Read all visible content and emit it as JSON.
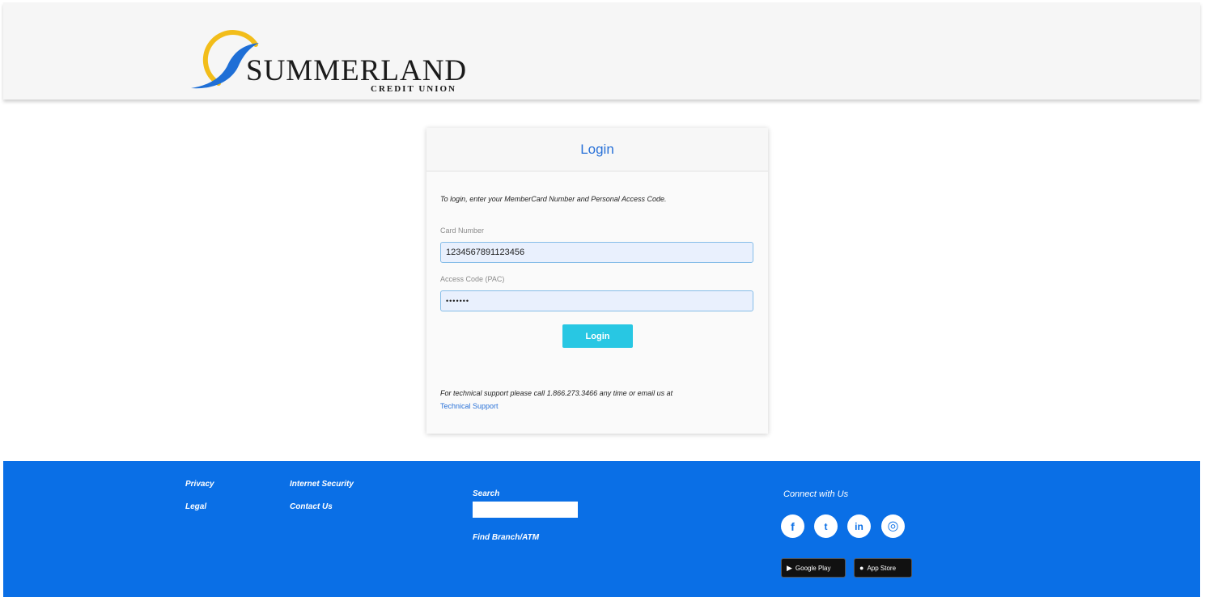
{
  "header": {
    "logo_word": "SUMMERLAND",
    "logo_sub": "CREDIT UNION"
  },
  "login": {
    "title": "Login",
    "instructions": "To login, enter your MemberCard Number and Personal Access Code.",
    "card_number_label": "Card Number",
    "card_number_value": "1234567891123456",
    "access_code_label": "Access Code (PAC)",
    "access_code_value": "•••••••",
    "button_label": "Login",
    "support_text": "For technical support please call 1.866.273.3466 any time or email us at",
    "support_link": "Technical Support"
  },
  "footer": {
    "links": {
      "privacy": "Privacy",
      "legal": "Legal",
      "internet_security": "Internet Security",
      "contact_us": "Contact Us"
    },
    "search_label": "Search",
    "search_value": "",
    "find_branch": "Find Branch/ATM",
    "connect_label": "Connect with Us",
    "social": {
      "facebook": "f",
      "twitter": "t",
      "linkedin": "in",
      "instagram": "◎"
    },
    "stores": {
      "google_play": "Google Play",
      "app_store": "App Store"
    }
  },
  "colors": {
    "footer_bg": "#0a6fe6",
    "login_button": "#28c7e3",
    "title_blue": "#2a72d8",
    "input_bg": "#e9f0fd",
    "logo_sun": "#f2bd1a",
    "logo_wave": "#1f6fd6"
  }
}
